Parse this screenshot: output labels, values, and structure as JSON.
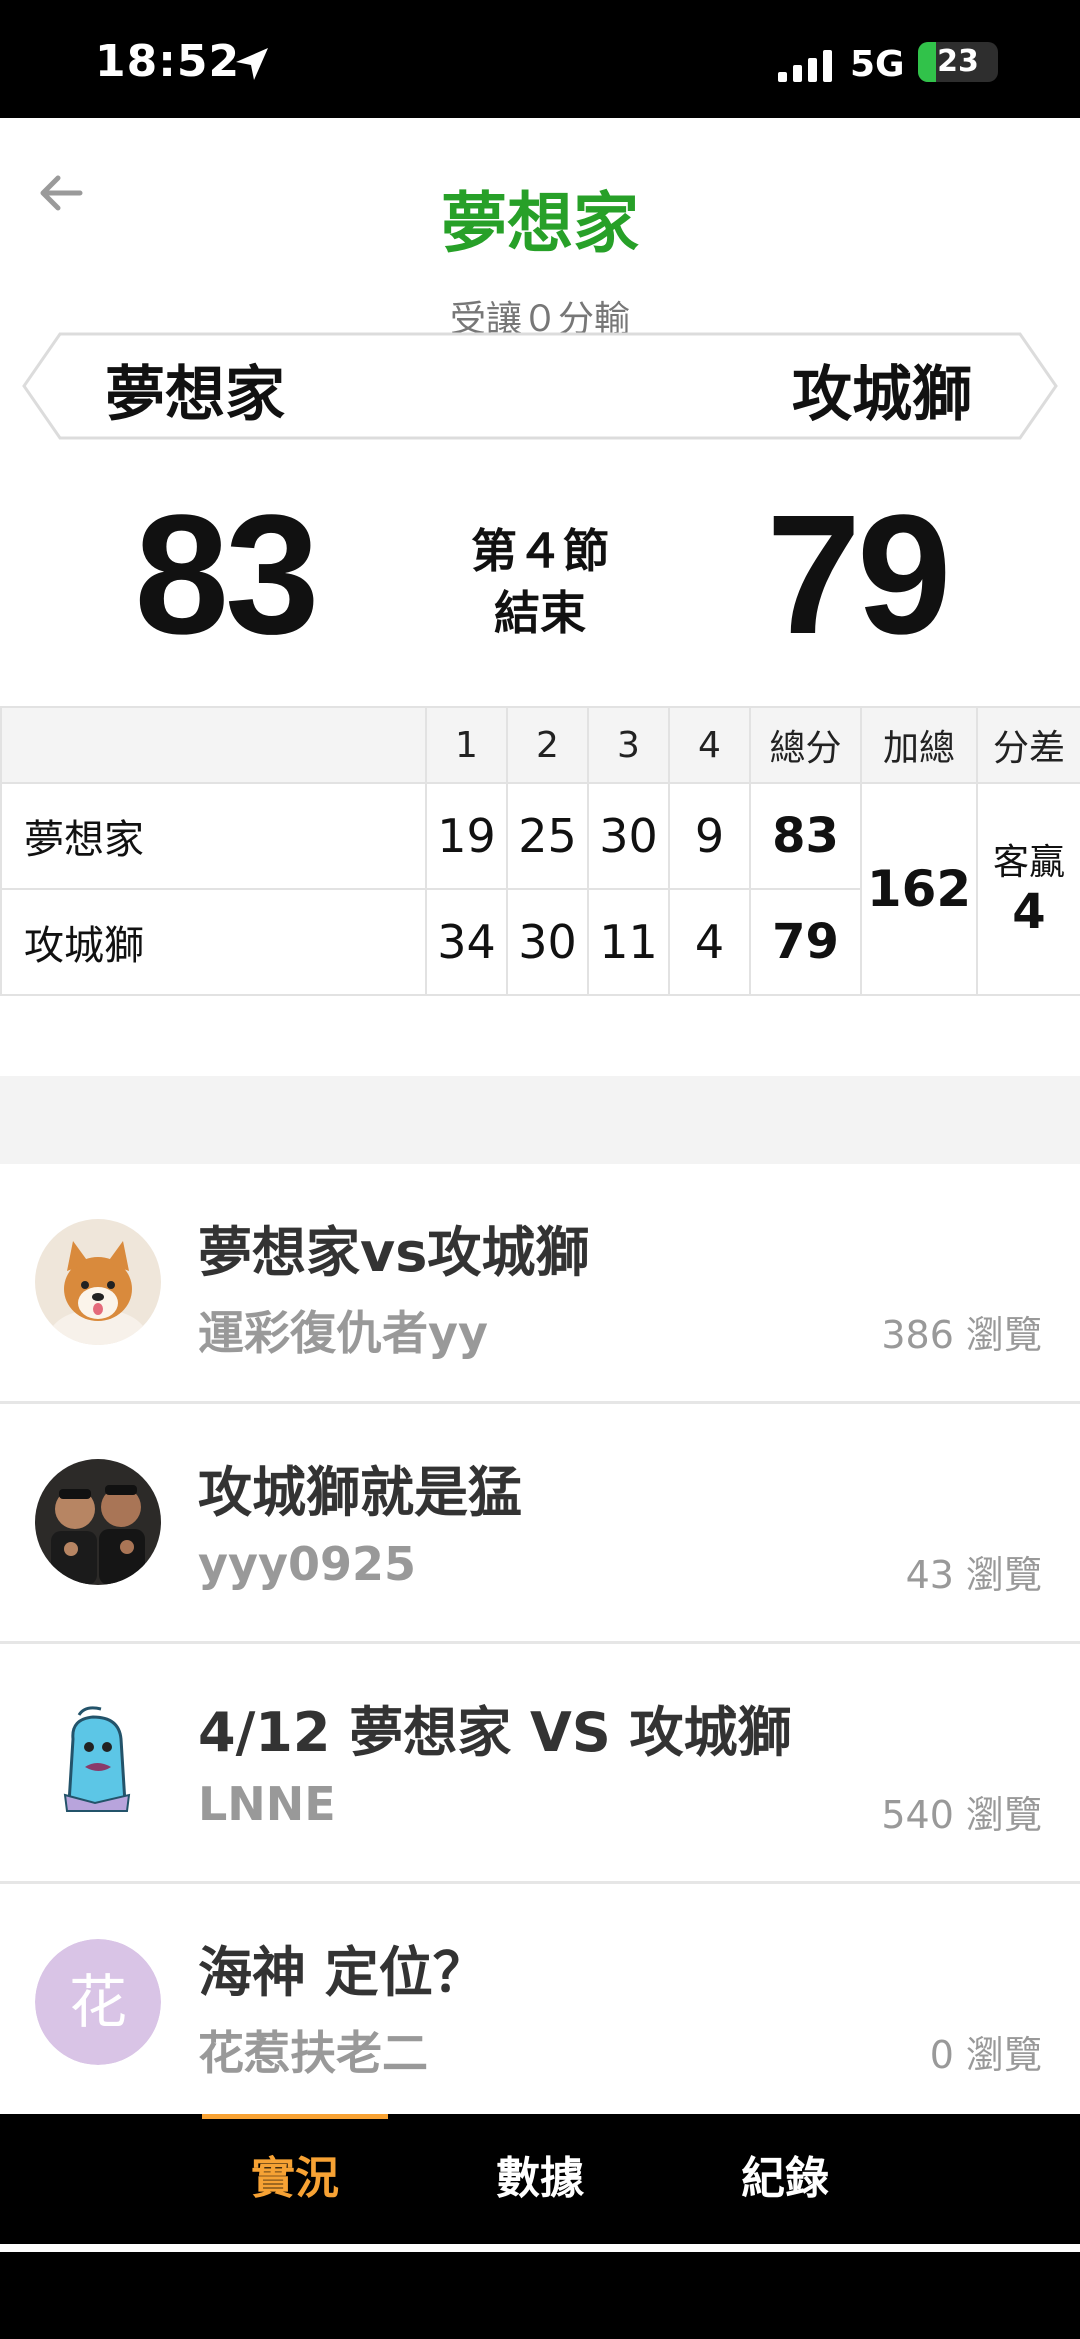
{
  "status_bar": {
    "time": "18:52",
    "network": "5G",
    "battery": "23",
    "battery_level": 0.23
  },
  "header": {
    "title": "夢想家",
    "handicap": "受讓０分輸",
    "home_team": "夢想家",
    "away_team": "攻城獅"
  },
  "score": {
    "home": "83",
    "away": "79",
    "period_line1": "第４節",
    "period_line2": "結束"
  },
  "box_score": {
    "headers": [
      "",
      "1",
      "2",
      "3",
      "4",
      "總分",
      "加總",
      "分差"
    ],
    "rows": [
      {
        "team": "夢想家",
        "q": [
          "19",
          "25",
          "30",
          "9"
        ],
        "total": "83"
      },
      {
        "team": "攻城獅",
        "q": [
          "34",
          "30",
          "11",
          "4"
        ],
        "total": "79"
      }
    ],
    "sum": "162",
    "diff_label": "客贏",
    "diff_value": "4"
  },
  "posts": [
    {
      "title": "夢想家vs攻城獅",
      "author": "運彩復仇者yy",
      "views": "386 瀏覽",
      "avatar": "shiba-dog-avatar"
    },
    {
      "title": "攻城獅就是猛",
      "author": "yyy0925",
      "views": "43 瀏覽",
      "avatar": "two-men-photo-avatar"
    },
    {
      "title": "4/12 夢想家 VS 攻城獅",
      "author": "LNNE",
      "views": "540 瀏覽",
      "avatar": "cartoon-character-avatar"
    },
    {
      "title": "海神 定位？",
      "author": "花惹扶老二",
      "views": "0 瀏覽",
      "avatar_letter": "花"
    }
  ],
  "tabs": [
    {
      "label": "實況",
      "active": true
    },
    {
      "label": "數據",
      "active": false
    },
    {
      "label": "紀錄",
      "active": false
    }
  ],
  "colors": {
    "title_green": "#27a028",
    "accent_orange": "#f7a234",
    "muted_gray": "#999999"
  }
}
